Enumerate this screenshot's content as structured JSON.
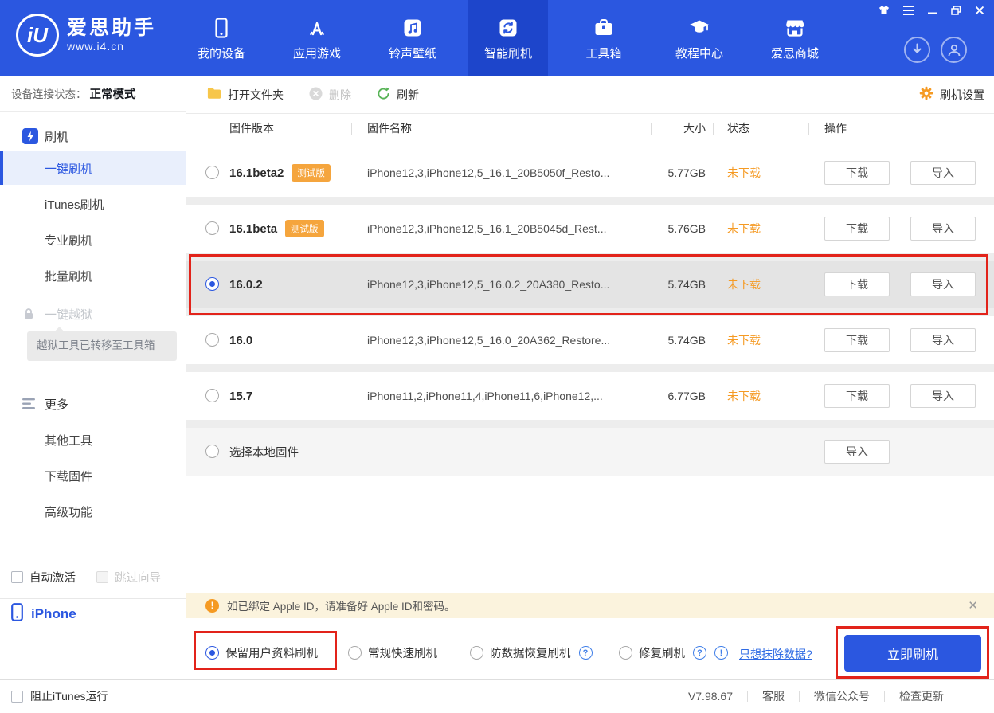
{
  "titlebar": {
    "brand_monogram": "iU",
    "brand_name": "爱思助手",
    "brand_url": "www.i4.cn",
    "nav": [
      {
        "label": "我的设备"
      },
      {
        "label": "应用游戏"
      },
      {
        "label": "铃声壁纸"
      },
      {
        "label": "智能刷机"
      },
      {
        "label": "工具箱"
      },
      {
        "label": "教程中心"
      },
      {
        "label": "爱思商城"
      }
    ]
  },
  "sidebar": {
    "device_status_label": "设备连接状态：",
    "device_status_value": "正常模式",
    "flash_header": "刷机",
    "flash_items": [
      "一键刷机",
      "iTunes刷机",
      "专业刷机",
      "批量刷机"
    ],
    "jailbreak": "一键越狱",
    "jailbreak_note": "越狱工具已转移至工具箱",
    "more_header": "更多",
    "more_items": [
      "其他工具",
      "下载固件",
      "高级功能"
    ],
    "auto_activate": "自动激活",
    "skip_wizard": "跳过向导",
    "device_name": "iPhone"
  },
  "toolbar": {
    "open_folder": "打开文件夹",
    "delete": "删除",
    "refresh": "刷新",
    "settings": "刷机设置"
  },
  "table": {
    "headers": [
      "固件版本",
      "固件名称",
      "大小",
      "状态",
      "操作"
    ],
    "actions": {
      "download": "下载",
      "import": "导入"
    },
    "rows": [
      {
        "version": "16.1beta2",
        "badge": "测试版",
        "name": "iPhone12,3,iPhone12,5_16.1_20B5050f_Resto...",
        "size": "5.77GB",
        "status": "未下载",
        "selected": false
      },
      {
        "version": "16.1beta",
        "badge": "测试版",
        "name": "iPhone12,3,iPhone12,5_16.1_20B5045d_Rest...",
        "size": "5.76GB",
        "status": "未下载",
        "selected": false
      },
      {
        "version": "16.0.2",
        "name": "iPhone12,3,iPhone12,5_16.0.2_20A380_Resto...",
        "size": "5.74GB",
        "status": "未下载",
        "selected": true
      },
      {
        "version": "16.0",
        "name": "iPhone12,3,iPhone12,5_16.0_20A362_Restore...",
        "size": "5.74GB",
        "status": "未下载",
        "selected": false
      },
      {
        "version": "15.7",
        "name": "iPhone11,2,iPhone11,4,iPhone11,6,iPhone12,...",
        "size": "6.77GB",
        "status": "未下载",
        "selected": false
      },
      {
        "version": "选择本地固件",
        "selected": false
      }
    ]
  },
  "notice": {
    "text": "如已绑定 Apple ID，请准备好 Apple ID和密码。"
  },
  "options": {
    "items": [
      {
        "label": "保留用户资料刷机",
        "selected": true
      },
      {
        "label": "常规快速刷机",
        "selected": false
      },
      {
        "label": "防数据恢复刷机",
        "selected": false
      },
      {
        "label": "修复刷机",
        "selected": false
      }
    ],
    "erase_link": "只想抹除数据?",
    "flash_now": "立即刷机"
  },
  "footer": {
    "block_itunes": "阻止iTunes运行",
    "version": "V7.98.67",
    "links": [
      "客服",
      "微信公众号",
      "检查更新"
    ]
  },
  "icons": {
    "question_mark": "?",
    "exclamation": "!",
    "close": "✕"
  },
  "colors": {
    "accent_blue": "#2b57e0",
    "status_orange": "#f59a23",
    "annotation_red": "#e2231a",
    "badge_orange": "#f5a53d"
  }
}
